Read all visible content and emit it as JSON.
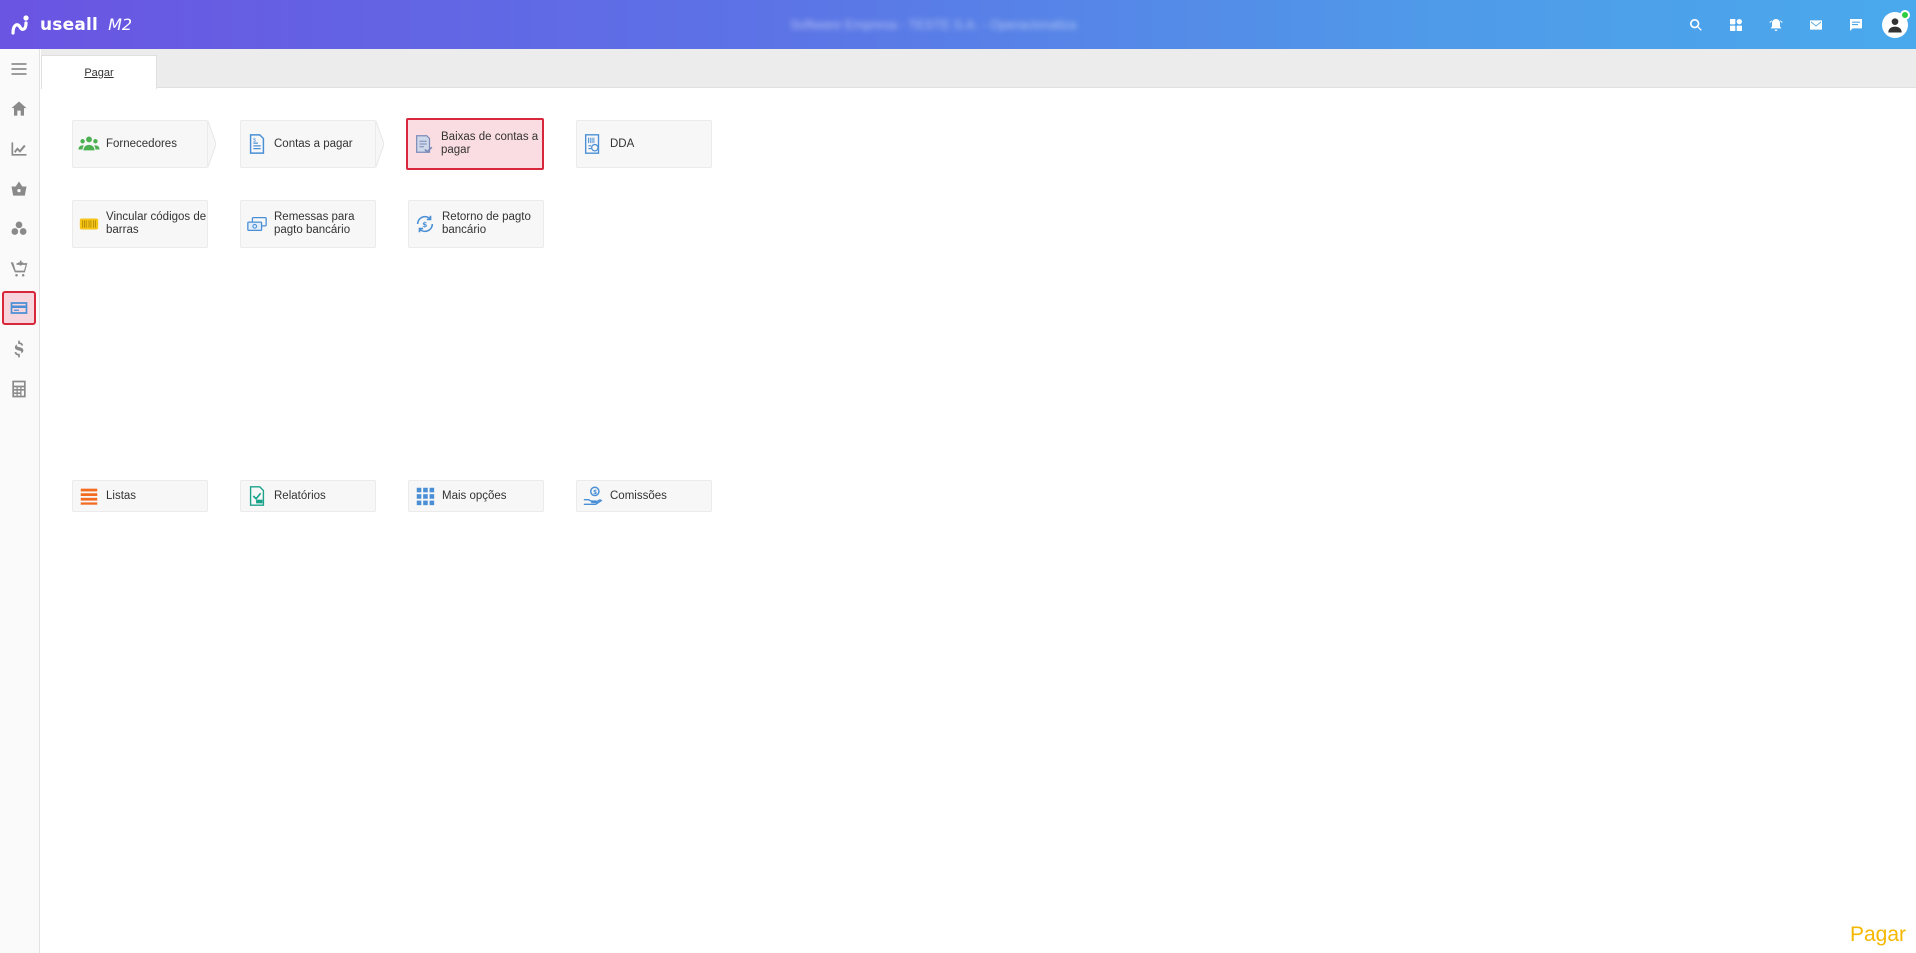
{
  "app": {
    "logo_text": "useall",
    "logo_version": "M2",
    "company_blurred": "Software Empresa - TESTE S.A. - Operacionaliza"
  },
  "topbar": {
    "icons": [
      "search-icon",
      "dashboard-icon",
      "notification-icon",
      "mail-icon",
      "chat-icon"
    ]
  },
  "sidebar": {
    "items": [
      {
        "name": "menu-icon"
      },
      {
        "name": "home-icon"
      },
      {
        "name": "chart-icon"
      },
      {
        "name": "basket-icon"
      },
      {
        "name": "boxes-icon"
      },
      {
        "name": "cart-icon"
      },
      {
        "name": "card-icon",
        "active": true
      },
      {
        "name": "dollar-icon"
      },
      {
        "name": "calculator-icon"
      }
    ]
  },
  "tabs": [
    {
      "label": "Pagar"
    }
  ],
  "tiles": {
    "row1": [
      {
        "label": "Fornecedores",
        "icon": "suppliers-icon"
      },
      {
        "label": "Contas a pagar",
        "icon": "bill-icon"
      },
      {
        "label": "Baixas de contas a pagar",
        "icon": "payment-settle-icon",
        "selected": true
      },
      {
        "label": "DDA",
        "icon": "dda-icon"
      }
    ],
    "row2": [
      {
        "label": "Vincular códigos de barras",
        "icon": "barcode-icon"
      },
      {
        "label": "Remessas para pagto bancário",
        "icon": "bank-remittance-icon"
      },
      {
        "label": "Retorno de pagto bancário",
        "icon": "bank-return-icon"
      }
    ],
    "row3": [
      {
        "label": "Listas",
        "icon": "list-icon"
      },
      {
        "label": "Relatórios",
        "icon": "report-icon"
      },
      {
        "label": "Mais opções",
        "icon": "grid-icon"
      },
      {
        "label": "Comissões",
        "icon": "commission-icon"
      }
    ]
  },
  "footer": {
    "label": "Pagar"
  },
  "colors": {
    "accent": "#d8263b",
    "brand_start": "#6a54e2",
    "brand_end": "#4aa9ec",
    "footer": "#f5b800"
  }
}
